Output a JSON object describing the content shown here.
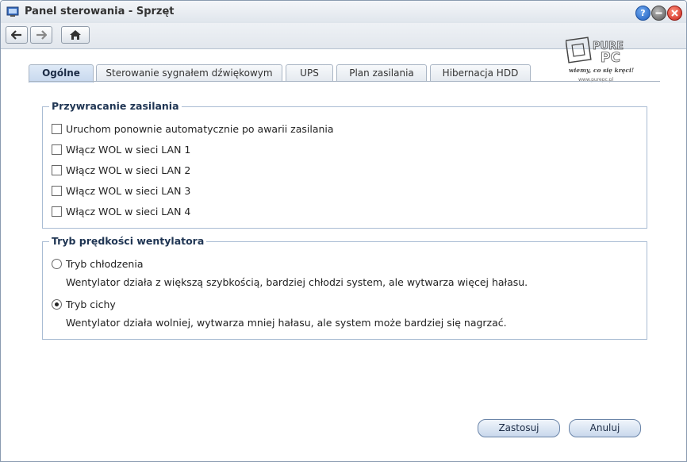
{
  "window": {
    "title": "Panel sterowania - Sprzęt",
    "help_label": "?"
  },
  "watermark": {
    "brand_top": "PURE",
    "brand_bottom": "PC",
    "tagline": "wiemy, co się kręci!",
    "url": "www.purepc.pl"
  },
  "tabs": [
    {
      "label": "Ogólne",
      "active": true
    },
    {
      "label": "Sterowanie sygnałem dźwiękowym",
      "active": false
    },
    {
      "label": "UPS",
      "active": false
    },
    {
      "label": "Plan zasilania",
      "active": false
    },
    {
      "label": "Hibernacja HDD",
      "active": false
    }
  ],
  "power_recovery": {
    "legend": "Przywracanie zasilania",
    "options": [
      {
        "label": "Uruchom ponownie automatycznie po awarii zasilania",
        "checked": false
      },
      {
        "label": "Włącz WOL w sieci LAN 1",
        "checked": false
      },
      {
        "label": "Włącz WOL w sieci LAN 2",
        "checked": false
      },
      {
        "label": "Włącz WOL w sieci LAN 3",
        "checked": false
      },
      {
        "label": "Włącz WOL w sieci LAN 4",
        "checked": false
      }
    ]
  },
  "fan_speed": {
    "legend": "Tryb prędkości wentylatora",
    "options": [
      {
        "label": "Tryb chłodzenia",
        "description": "Wentylator działa z większą szybkością, bardziej chłodzi system, ale wytwarza więcej hałasu.",
        "selected": false
      },
      {
        "label": "Tryb cichy",
        "description": "Wentylator działa wolniej, wytwarza mniej hałasu, ale system może bardziej się nagrzać.",
        "selected": true
      }
    ]
  },
  "buttons": {
    "apply": "Zastosuj",
    "cancel": "Anuluj"
  },
  "colors": {
    "accent": "#1f3553",
    "active_tab": "#c7d8ee",
    "border": "#a9bcd3"
  }
}
